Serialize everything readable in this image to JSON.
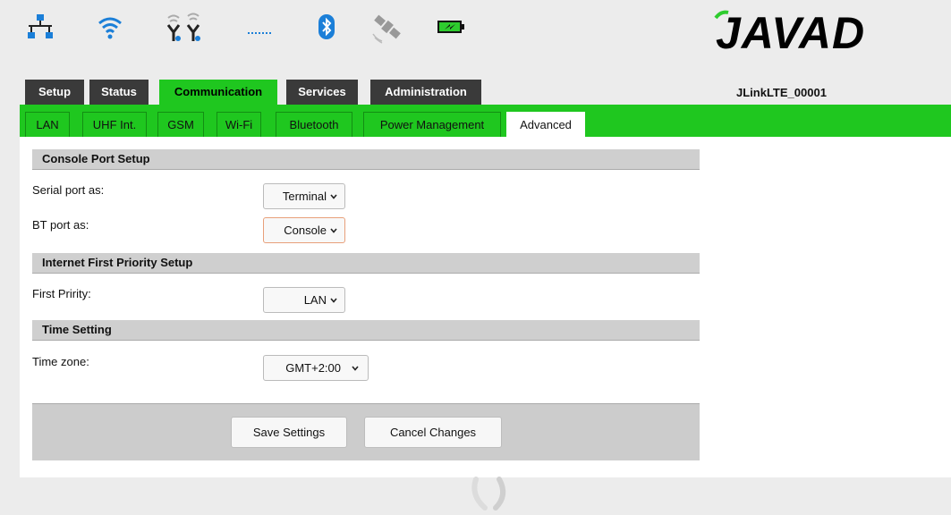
{
  "status_icons": [
    "network-icon",
    "wifi-icon",
    "uhf-antenna-icon",
    "dots-icon",
    "bluetooth-icon",
    "satellite-icon",
    "battery-icon"
  ],
  "brand": {
    "logo_text": "JAVAD"
  },
  "tabs": [
    "Setup",
    "Status",
    "Communication",
    "Services",
    "Administration"
  ],
  "active_tab": "Communication",
  "device_name": "JLinkLTE_00001",
  "subtabs": [
    "LAN",
    "UHF Int.",
    "GSM",
    "Wi-Fi",
    "Bluetooth",
    "Power Management",
    "Advanced"
  ],
  "active_subtab": "Advanced",
  "sections": {
    "console": {
      "title": "Console Port Setup",
      "serial_label": "Serial port as:",
      "serial_value": "Terminal",
      "bt_label": "BT port as:",
      "bt_value": "Console"
    },
    "internet": {
      "title": "Internet First Priority Setup",
      "first_label": "First Pririty:",
      "first_value": "LAN"
    },
    "time": {
      "title": "Time Setting",
      "zone_label": "Time zone:",
      "zone_value": "GMT+2:00"
    }
  },
  "buttons": {
    "save": "Save Settings",
    "cancel": "Cancel Changes"
  },
  "colors": {
    "accent_green": "#1fc71f",
    "tab_dark": "#3a3a3a",
    "section_gray": "#cfcfcf"
  }
}
